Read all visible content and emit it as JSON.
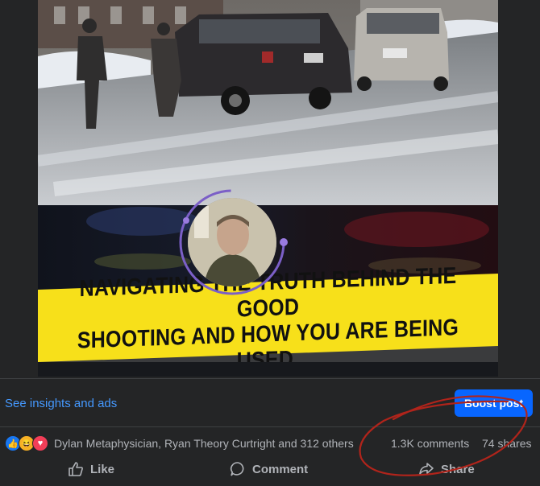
{
  "post": {
    "caption_line1": "NAVIGATING THE TRUTH BEHIND THE GOOD",
    "caption_line2": "SHOOTING AND HOW YOU ARE BEING USED."
  },
  "admin_bar": {
    "insights_label": "See insights and ads",
    "boost_label": "Boost post"
  },
  "stats": {
    "reactions": [
      "like",
      "haha",
      "love"
    ],
    "reactors_text": "Dylan Metaphysician, Ryan Theory Curtright and 312 others",
    "comments_text": "1.3K comments",
    "shares_text": "74 shares"
  },
  "actions": {
    "like_label": "Like",
    "comment_label": "Comment",
    "share_label": "Share"
  },
  "colors": {
    "background": "#242526",
    "accent": "#0866ff",
    "link": "#4599ff",
    "muted_text": "#b0b3b8",
    "annotation": "#b0241b",
    "caption_band": "#f7e01a"
  }
}
